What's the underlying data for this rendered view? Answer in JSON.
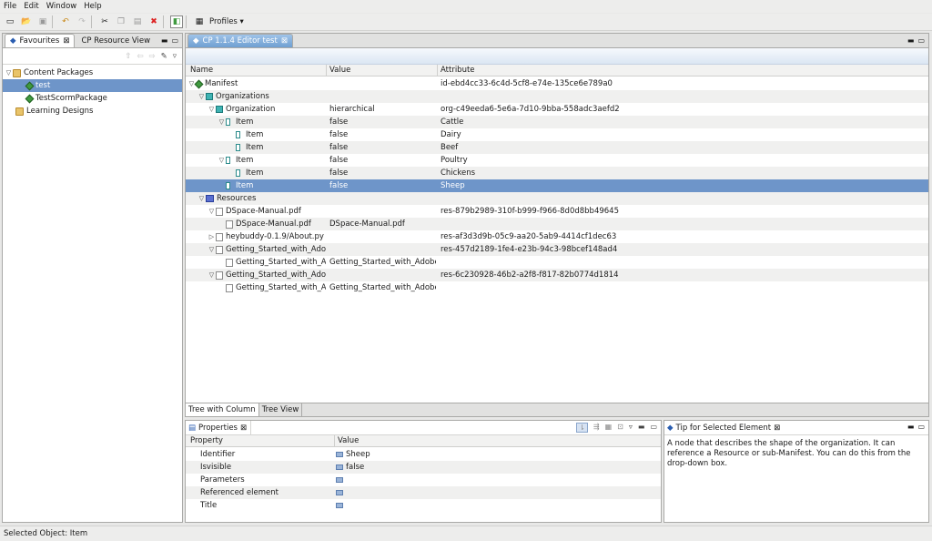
{
  "menubar": {
    "items": [
      "File",
      "Edit",
      "Window",
      "Help"
    ]
  },
  "toolbar": {
    "profiles_label": "Profiles"
  },
  "left_panel": {
    "tabs": [
      {
        "label": "Favourites"
      },
      {
        "label": "CP Resource View"
      }
    ],
    "tree": [
      {
        "label": "Content Packages",
        "icon": "folder-icon",
        "level": 0,
        "expanded": true
      },
      {
        "label": "test",
        "icon": "package-icon",
        "level": 1,
        "selected": true
      },
      {
        "label": "TestScormPackage",
        "icon": "package-icon",
        "level": 1
      },
      {
        "label": "Learning Designs",
        "icon": "folder-icon",
        "level": 0
      }
    ]
  },
  "editor": {
    "tab_label": "CP 1.1.4 Editor  test",
    "columns": [
      "Name",
      "Value",
      "Attribute"
    ],
    "rows": [
      {
        "name": "Manifest",
        "value": "",
        "attribute": "id-ebd4cc33-6c4d-5cf8-e74e-135ce6e789a0",
        "indent": 0,
        "twisty": "open",
        "icon": "manifest-icon"
      },
      {
        "name": "Organizations",
        "value": "",
        "attribute": "",
        "indent": 1,
        "twisty": "open",
        "icon": "organizations-icon"
      },
      {
        "name": "Organization",
        "value": "hierarchical",
        "attribute": "org-c49eeda6-5e6a-7d10-9bba-558adc3aefd2",
        "indent": 2,
        "twisty": "open",
        "icon": "organization-icon"
      },
      {
        "name": "Item",
        "value": "false",
        "attribute": "Cattle",
        "indent": 3,
        "twisty": "open",
        "icon": "item-icon"
      },
      {
        "name": "Item",
        "value": "false",
        "attribute": "Dairy",
        "indent": 4,
        "twisty": "",
        "icon": "item-icon"
      },
      {
        "name": "Item",
        "value": "false",
        "attribute": "Beef",
        "indent": 4,
        "twisty": "",
        "icon": "item-icon"
      },
      {
        "name": "Item",
        "value": "false",
        "attribute": "Poultry",
        "indent": 3,
        "twisty": "open",
        "icon": "item-icon"
      },
      {
        "name": "Item",
        "value": "false",
        "attribute": "Chickens",
        "indent": 4,
        "twisty": "",
        "icon": "item-icon"
      },
      {
        "name": "Item",
        "value": "false",
        "attribute": "Sheep",
        "indent": 3,
        "twisty": "",
        "icon": "item-icon",
        "selected": true
      },
      {
        "name": "Resources",
        "value": "",
        "attribute": "",
        "indent": 1,
        "twisty": "open",
        "icon": "resources-icon"
      },
      {
        "name": "DSpace-Manual.pdf",
        "value": "",
        "attribute": "res-879b2989-310f-b999-f966-8d0d8bb49645",
        "indent": 2,
        "twisty": "open",
        "icon": "resource-icon"
      },
      {
        "name": "DSpace-Manual.pdf",
        "value": "DSpace-Manual.pdf",
        "attribute": "",
        "indent": 3,
        "twisty": "",
        "icon": "file-icon"
      },
      {
        "name": "heybuddy-0.1.9/About.py",
        "value": "",
        "attribute": "res-af3d3d9b-05c9-aa20-5ab9-4414cf1dec63",
        "indent": 2,
        "twisty": "closed",
        "icon": "resource-icon"
      },
      {
        "name": "Getting_Started_with_Adob",
        "value": "",
        "attribute": "res-457d2189-1fe4-e23b-94c3-98bcef148ad4",
        "indent": 2,
        "twisty": "open",
        "icon": "resource-icon"
      },
      {
        "name": "Getting_Started_with_A",
        "value": "Getting_Started_with_Adobe_",
        "attribute": "",
        "indent": 3,
        "twisty": "",
        "icon": "file-icon"
      },
      {
        "name": "Getting_Started_with_Adob",
        "value": "",
        "attribute": "res-6c230928-46b2-a2f8-f817-82b0774d1814",
        "indent": 2,
        "twisty": "open",
        "icon": "resource-icon"
      },
      {
        "name": "Getting_Started_with_A",
        "value": "Getting_Started_with_Adobe_",
        "attribute": "",
        "indent": 3,
        "twisty": "",
        "icon": "file-icon"
      }
    ],
    "bottom_tabs": [
      "Tree with Column",
      "Tree View"
    ]
  },
  "properties": {
    "tab_label": "Properties",
    "columns": [
      "Property",
      "Value"
    ],
    "rows": [
      {
        "property": "Identifier",
        "value": "Sheep"
      },
      {
        "property": "Isvisible",
        "value": "false"
      },
      {
        "property": "Parameters",
        "value": ""
      },
      {
        "property": "Referenced element",
        "value": ""
      },
      {
        "property": "Title",
        "value": ""
      }
    ]
  },
  "tip": {
    "tab_label": "Tip for Selected Element",
    "text": "A node that describes the shape of the organization. It can reference a Resource or sub-Manifest. You can do this from the drop-down box."
  },
  "status": {
    "text": "Selected Object: Item"
  },
  "colors": {
    "selection": "#6e95c9",
    "accent": "#3f9a3f"
  }
}
